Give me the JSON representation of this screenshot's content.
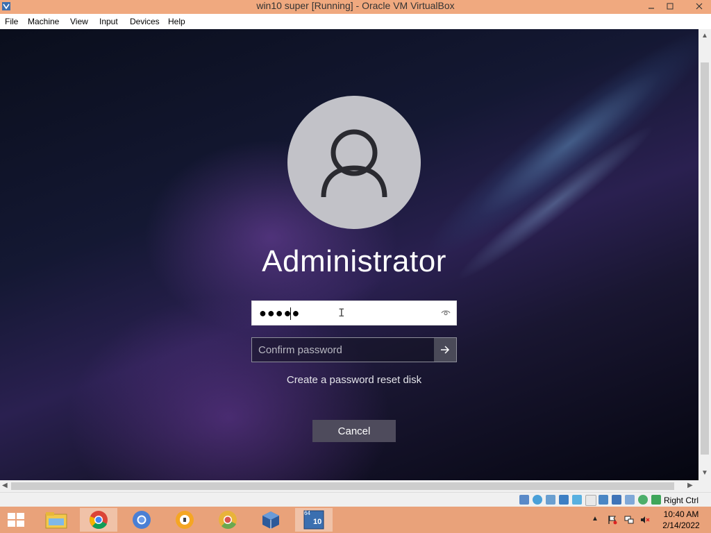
{
  "window": {
    "title": "win10 super [Running] - Oracle VM VirtualBox"
  },
  "menu": {
    "items": [
      {
        "label": "File"
      },
      {
        "label": "Machine"
      },
      {
        "label": "View"
      },
      {
        "label": "Input"
      },
      {
        "label": "Devices"
      },
      {
        "label": "Help"
      }
    ]
  },
  "login": {
    "username": "Administrator",
    "password_masked": "●●●●●",
    "confirm_placeholder": "Confirm password",
    "reset_link": "Create a password reset disk",
    "cancel_label": "Cancel"
  },
  "statusbar": {
    "host_key": "Right Ctrl",
    "icons": [
      "hard-disk-icon",
      "optical-drive-icon",
      "audio-icon",
      "network-icon",
      "usb-icon",
      "shared-folders-icon",
      "display-icon",
      "video-capture-icon",
      "mouse-integration-icon",
      "cpu-icon",
      "guest-additions-icon"
    ]
  },
  "taskbar": {
    "items": [
      {
        "name": "file-explorer"
      },
      {
        "name": "chrome",
        "active": true
      },
      {
        "name": "chromium"
      },
      {
        "name": "vpn-app"
      },
      {
        "name": "chrome-canary"
      },
      {
        "name": "virtualbox"
      },
      {
        "name": "win10-vm",
        "active": true,
        "badge": "10",
        "bits": "64"
      }
    ],
    "clock": {
      "time": "10:40 AM",
      "date": "2/14/2022"
    }
  },
  "colors": {
    "titlebar": "#f0a97f",
    "taskbar": "#e9a27a",
    "avatar": "#c2c2c8",
    "cancel_button": "#4e4b5c"
  }
}
